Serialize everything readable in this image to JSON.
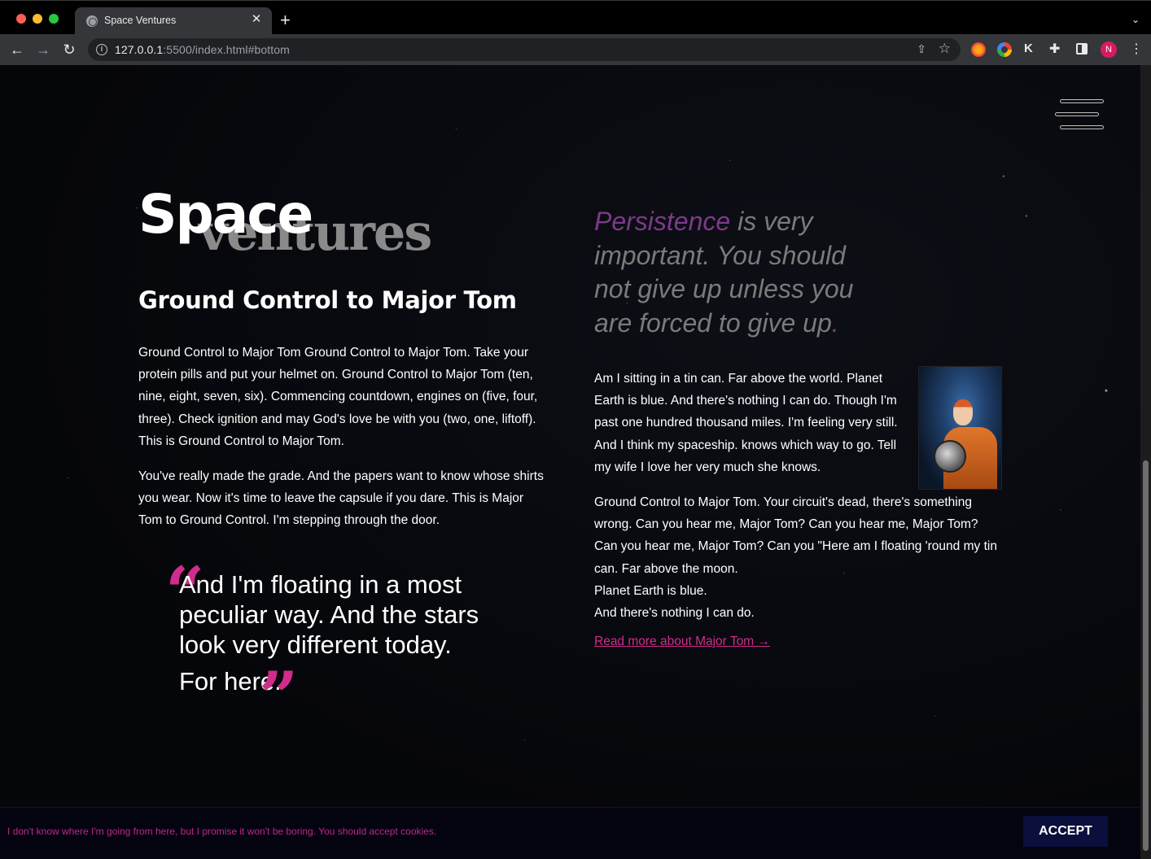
{
  "browser": {
    "tab_title": "Space Ventures",
    "tab_close": "✕",
    "new_tab": "+",
    "url_host": "127.0.0.1",
    "url_rest": ":5500/index.html#bottom",
    "avatar_letter": "N",
    "extension_k": "K"
  },
  "logo": {
    "word1": "Space",
    "word2": "ventures"
  },
  "main": {
    "heading": "Ground Control to Major Tom",
    "paragraph1": "Ground Control to Major Tom Ground Control to Major Tom. Take your protein pills and put your helmet on. Ground Control to Major Tom (ten, nine, eight, seven, six). Commencing countdown, engines on (five, four, three). Check ignition and may God's love be with you (two, one, liftoff). This is Ground Control to Major Tom.",
    "paragraph2": "You've really made the grade. And the papers want to know whose shirts you wear. Now it's time to leave the capsule if you dare. This is Major Tom to Ground Control. I'm stepping through the door.",
    "blockquote_line1": "And I'm floating in a most peculiar way. And the stars look very different today.",
    "blockquote_line2": "For here."
  },
  "sidebar": {
    "pull_quote_accent": "Persistence",
    "pull_quote_rest": " is very important. You should not give up unless you are forced to give up",
    "pull_quote_dot": ".",
    "paragraph1": "Am I sitting in a tin can. Far above the world. Planet Earth is blue. And there's nothing I can do. Though I'm past one hundred thousand miles. I'm feeling very still. And I think my spaceship. knows which way to go. Tell my wife I love her very much she knows.",
    "paragraph2_a": "Ground Control to Major Tom. Your circuit's dead, there's something wrong. Can you hear me, Major Tom? Can you hear me, Major Tom? Can you hear me, Major Tom? Can you \"Here am I floating 'round my tin can. Far above the moon.",
    "paragraph2_b": "Planet Earth is blue.",
    "paragraph2_c": "And there's nothing I can do.",
    "read_more": "Read more about Major Tom →"
  },
  "cookie": {
    "text": "I don't know where I'm going from here, but I promise it won't be boring. You should accept cookies.",
    "button": "ACCEPT"
  },
  "colors": {
    "accent": "#d12c8b",
    "cookie_bg": "#03040f",
    "button_bg": "#0a0f3c"
  },
  "icons": [
    "globe-icon",
    "back-icon",
    "forward-icon",
    "reload-icon",
    "info-icon",
    "share-icon",
    "star-icon",
    "puzzle-icon",
    "side-panel-icon",
    "kebab-menu-icon",
    "hamburger-menu-icon",
    "quote-open-icon",
    "quote-close-icon"
  ]
}
